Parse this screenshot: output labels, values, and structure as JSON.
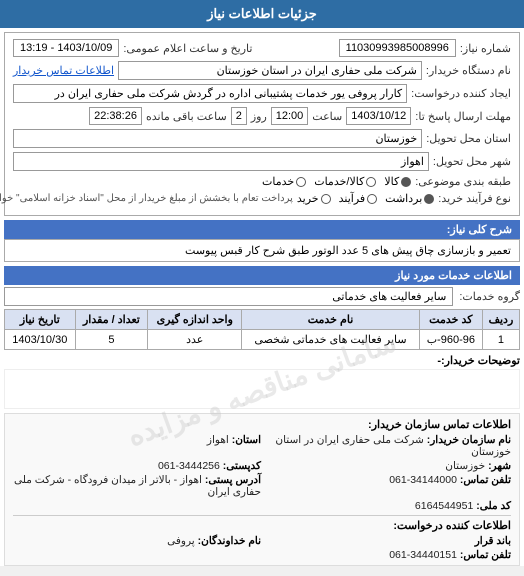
{
  "header": {
    "title": "جزئیات اطلاعات نیاز"
  },
  "top_info": {
    "shmare_label": "شماره نیاز:",
    "shmare_value": "11030993985008996",
    "date_label": "تاریخ و ساعت اعلام عمومی:",
    "date_value": "1403/10/09 - 13:19"
  },
  "form": {
    "maghza_label": "نام دستگاه خریدار:",
    "maghza_value": "شرکت ملی حفاری ایران در استان خوزستان",
    "maghza_link": "اطلاعات تماس خریدار",
    "ijad_label": "ایجاد کننده درخواست:",
    "ijad_value": "کارار پروفی یور خدمات پشتیبانی اداره در گردش شرکت ملی حفاری ایران در",
    "ersal_label": "مهلت ارسال پاسخ تا:",
    "ersal_date": "1403/10/12",
    "ersal_saaat": "12:00",
    "ersal_roz": "2",
    "ersal_baghimande": "22:38:26",
    "ostan_label": "استان محل تحویل:",
    "ostan_value": "خوزستان",
    "shahr_label": "شهر محل تحویل:",
    "shahr_value": "اهواز",
    "tabaghe_label": "طبقه بندی موضوعی:",
    "tabaghe_kala": "کالا",
    "tabaghe_khadamat": "کالا/خدمات",
    "tabaghe_khadamat2": "خدمات",
    "now_farande_label": "نوع فرآیند خرید:",
    "now_farande_prdakht": "پرداخت تعام با بخشش از مبلغ خریدار از محل \"اسناد خزانه اسلامی\" خواهد بود.",
    "now_farande_faranide": "فرآیند",
    "now_farande_kharid": "خرید"
  },
  "sharh_koli": {
    "label": "شرح کلی نیاز:",
    "value": "تعمیر و بازسازی چاق پیش های 5 عدد الوتور طبق شرح کار قبس پیوست"
  },
  "khadamat": {
    "label": "اطلاعات خدمات مورد نیاز",
    "grooh_label": "گروه خدمات:",
    "grooh_value": "سایر فعالیت های خدماتی",
    "table_headers": [
      "ردیف",
      "کد خدمت",
      "نام خدمت",
      "واحد اندازه گیری",
      "تعداد / مقدار",
      "تاریخ نیاز"
    ],
    "table_rows": [
      {
        "radif": "1",
        "code": "960-96-ب",
        "name": "سایر فعالیت های خدماتی شخصی",
        "vahed": "عدد",
        "tedad": "5",
        "tarikh": "1403/10/30"
      }
    ]
  },
  "notes": {
    "label": "توضیحات خریدار:-",
    "watermark": "سامانی مناقصه و مزایده"
  },
  "contact_buyer": {
    "title": "اطلاعات تماس سازمان خریدار:",
    "name_label": "نام سازمان خریدار:",
    "name_value": "شرکت ملی حفاری ایران در استان خوزستان",
    "ostan_label": "استان:",
    "ostan_value": "اهواز",
    "shahr_label": "شهر:",
    "shahr_value": "خوزستان",
    "postal_label": "کدپستی:",
    "postal_value": "3444256-061",
    "tel_label": "تلفن تماس:",
    "tel_value": "34144000-061",
    "address_label": "آدرس پستی:",
    "address_value": "اهواز - بالاتر از میدان فرودگاه - شرکت ملی حفاری ایران",
    "code_label": "کد ملی:",
    "code_value": "6164544951"
  },
  "contact_requester": {
    "title": "اطلاعات کننده درخواست:",
    "name_label": "باند قرار",
    "name_value": "",
    "khodavand_label": "نام خداوندگان:",
    "khodavand_value": "پروفی",
    "tel_label": "تلفن تماس:",
    "tel_value": "34440151-061"
  }
}
